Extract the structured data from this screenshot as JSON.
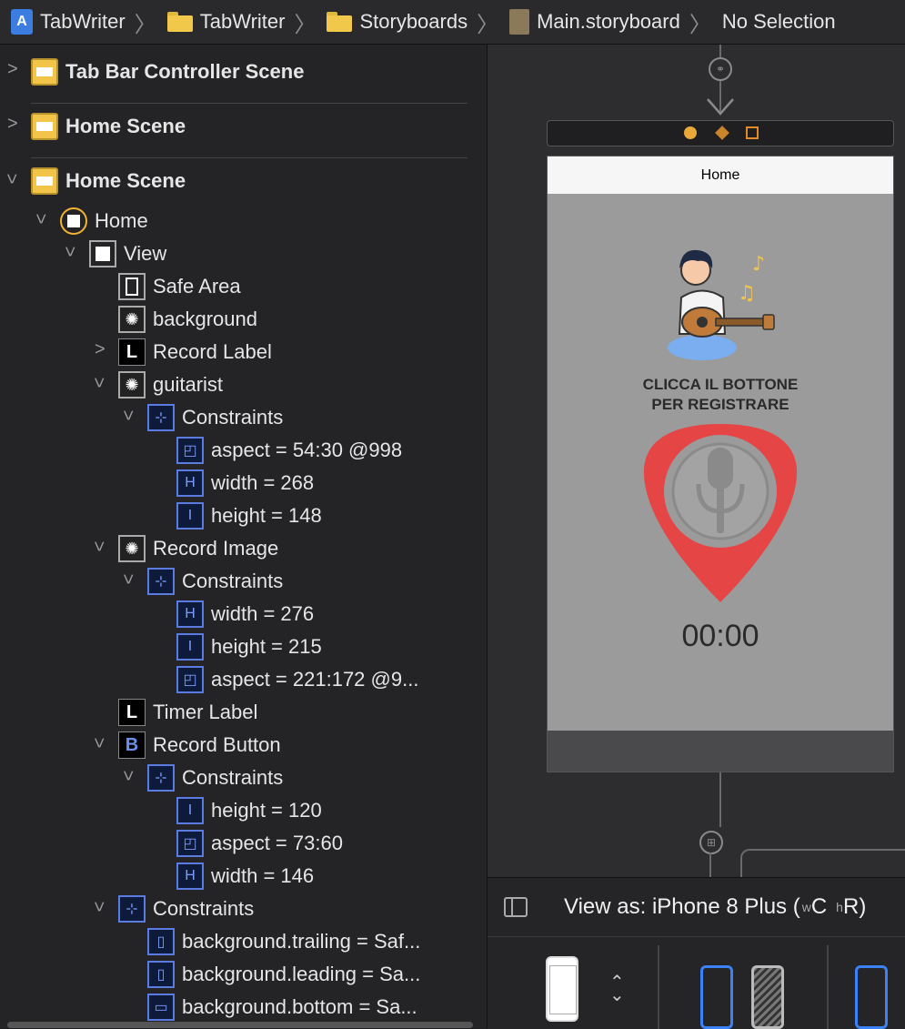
{
  "breadcrumb": {
    "items": [
      "TabWriter",
      "TabWriter",
      "Storyboards",
      "Main.storyboard",
      "No Selection"
    ],
    "separator": "〉"
  },
  "outline": {
    "scene1": "Tab Bar Controller Scene",
    "scene2": "Home Scene",
    "scene3": "Home Scene",
    "home": "Home",
    "view": "View",
    "safe_area": "Safe Area",
    "background": "background",
    "record_label": "Record Label",
    "guitarist": "guitarist",
    "constraints": "Constraints",
    "g_aspect": "aspect = 54:30 @998",
    "g_width": "width = 268",
    "g_height": "height = 148",
    "record_image": "Record Image",
    "ri_width": "width = 276",
    "ri_height": "height = 215",
    "ri_aspect": "aspect = 221:172 @9...",
    "timer_label": "Timer Label",
    "record_button": "Record Button",
    "rb_height": "height = 120",
    "rb_aspect": "aspect = 73:60",
    "rb_width": "width = 146",
    "bg_trailing": "background.trailing = Saf...",
    "bg_leading": "background.leading = Sa...",
    "bg_bottom": "background.bottom = Sa..."
  },
  "canvas": {
    "nav_title": "Home",
    "caption_line1": "CLICCA IL BOTTONE",
    "caption_line2": "PER REGISTRARE",
    "timer": "00:00"
  },
  "footer": {
    "view_as": "View as: iPhone 8 Plus (",
    "size_w": "w",
    "size_c": "C",
    "size_h": "h",
    "size_r": "R",
    "close_paren": ")"
  },
  "colors": {
    "pick_red": "#e64545",
    "accent_blue": "#3b82f6",
    "scene_yellow": "#f2c54a"
  }
}
